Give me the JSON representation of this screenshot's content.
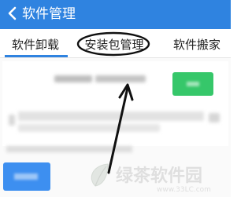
{
  "colors": {
    "brand": "#2f83e0",
    "action": "#36c76a",
    "secondary_button": "#3d8ff0"
  },
  "header": {
    "back_icon": "chevron-left-icon",
    "title": "软件管理"
  },
  "tabs": [
    {
      "label": "软件卸载",
      "selected": true
    },
    {
      "label": "安装包管理",
      "selected": false,
      "annotated": true
    },
    {
      "label": "软件搬家",
      "selected": false
    }
  ],
  "watermark": {
    "name": "绿茶软件园",
    "url": "www.33LC.com"
  }
}
